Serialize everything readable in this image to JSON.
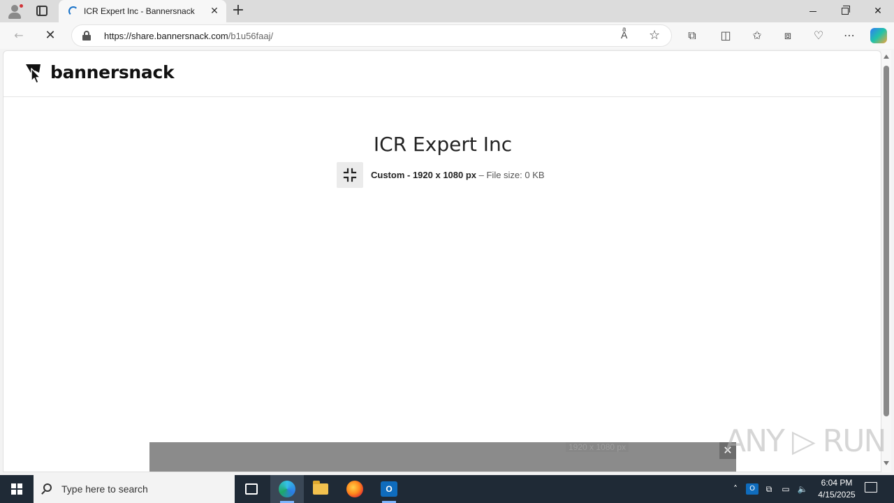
{
  "browser": {
    "tab": {
      "title": "ICR Expert Inc - Bannersnack"
    },
    "address": {
      "domain": "https://share.bannersnack.com",
      "path": "/b1u56faaj/"
    }
  },
  "site": {
    "logo_text": "bannersnack",
    "title": "ICR Expert Inc",
    "format_label": "Custom - 1920 x 1080 px",
    "file_size_text": " – File size: 0 KB"
  },
  "ad_bar": {
    "size_label": "1920 x 1080 px"
  },
  "watermark": {
    "text": "ANY ▷ RUN"
  },
  "taskbar": {
    "search_placeholder": "Type here to search",
    "time": "6:04 PM",
    "date": "4/15/2025"
  },
  "icons": {
    "edge": "edge-icon",
    "explorer": "file-explorer-icon",
    "firefox": "firefox-icon",
    "outlook": "outlook-icon"
  },
  "colors": {
    "taskbar": "#1f2a36",
    "ad_bar": "#8b8b8b",
    "accent_blue": "#1a73c9"
  }
}
